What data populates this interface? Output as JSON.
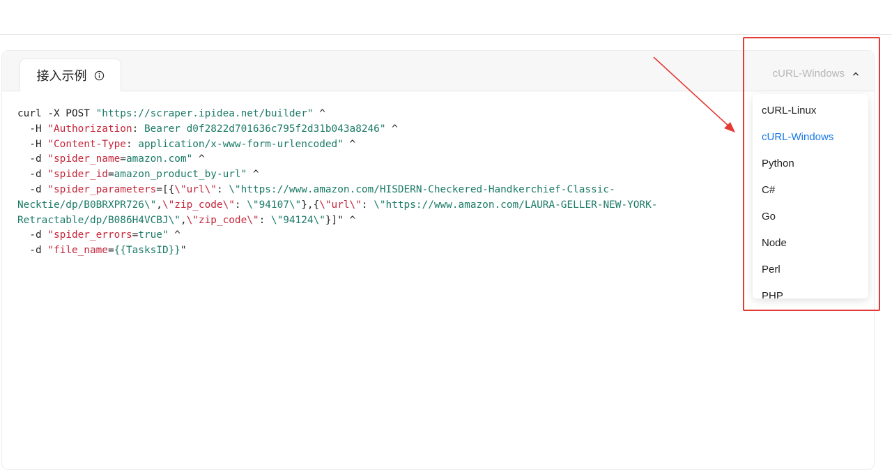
{
  "tab": {
    "label": "接入示例",
    "info_icon": "info-icon"
  },
  "language_select": {
    "value": "cURL-Windows",
    "icon": "chevron-up-icon",
    "options": [
      "cURL-Linux",
      "cURL-Windows",
      "Python",
      "C#",
      "Go",
      "Node",
      "Perl",
      "PHP"
    ],
    "selected_color": "#1677e6"
  },
  "code": {
    "line1": {
      "cmd": "curl -X POST ",
      "url": "\"https://scraper.ipidea.net/builder\"",
      "tail": " ^"
    },
    "line2": {
      "flag": "  -H ",
      "key": "\"Authorization",
      "sep": ": ",
      "val": "Bearer d0f2822d701636c795f2d31b043a8246\"",
      "tail": " ^"
    },
    "line3": {
      "flag": "  -H ",
      "key": "\"Content-Type",
      "sep": ": ",
      "val": "application/x-www-form-urlencoded\"",
      "tail": " ^"
    },
    "line4": {
      "flag": "  -d ",
      "key": "\"spider_name",
      "sep": "=",
      "val": "amazon.com\"",
      "tail": " ^"
    },
    "line5": {
      "flag": "  -d ",
      "key": "\"spider_id",
      "sep": "=",
      "val": "amazon_product_by-url\"",
      "tail": " ^"
    },
    "line6": {
      "flag": "  -d ",
      "key": "\"spider_parameters",
      "sep": "=[{",
      "k1": "\\\"url\\\"",
      "s1": ": ",
      "v1": "\\\"https://www.amazon.com/HISDERN-Checkered-Handkerchief-Classic-"
    },
    "line7": {
      "v1": "Necktie/dp/B0BRXPR726\\\"",
      "c1": ",",
      "k2": "\\\"zip_code\\\"",
      "s2": ": ",
      "v2": "\\\"94107\\\"",
      "c2": "},{",
      "k3": "\\\"url\\\"",
      "s3": ": ",
      "v3": "\\\"https://www.amazon.com/LAURA-GELLER-NEW-YORK-"
    },
    "line8": {
      "v1": "Retractable/dp/B086H4VCBJ\\\"",
      "c1": ",",
      "k2": "\\\"zip_code\\\"",
      "s2": ": ",
      "v2": "\\\"94124\\\"",
      "c2": "}]\"",
      "tail": " ^"
    },
    "line9": {
      "flag": "  -d ",
      "key": "\"spider_errors",
      "sep": "=",
      "val": "true\"",
      "tail": " ^"
    },
    "line10": {
      "flag": "  -d ",
      "key": "\"file_name",
      "sep": "=",
      "val": "{{TasksID}}",
      "tail": "\""
    }
  },
  "annotation": {
    "color": "#e53935"
  }
}
